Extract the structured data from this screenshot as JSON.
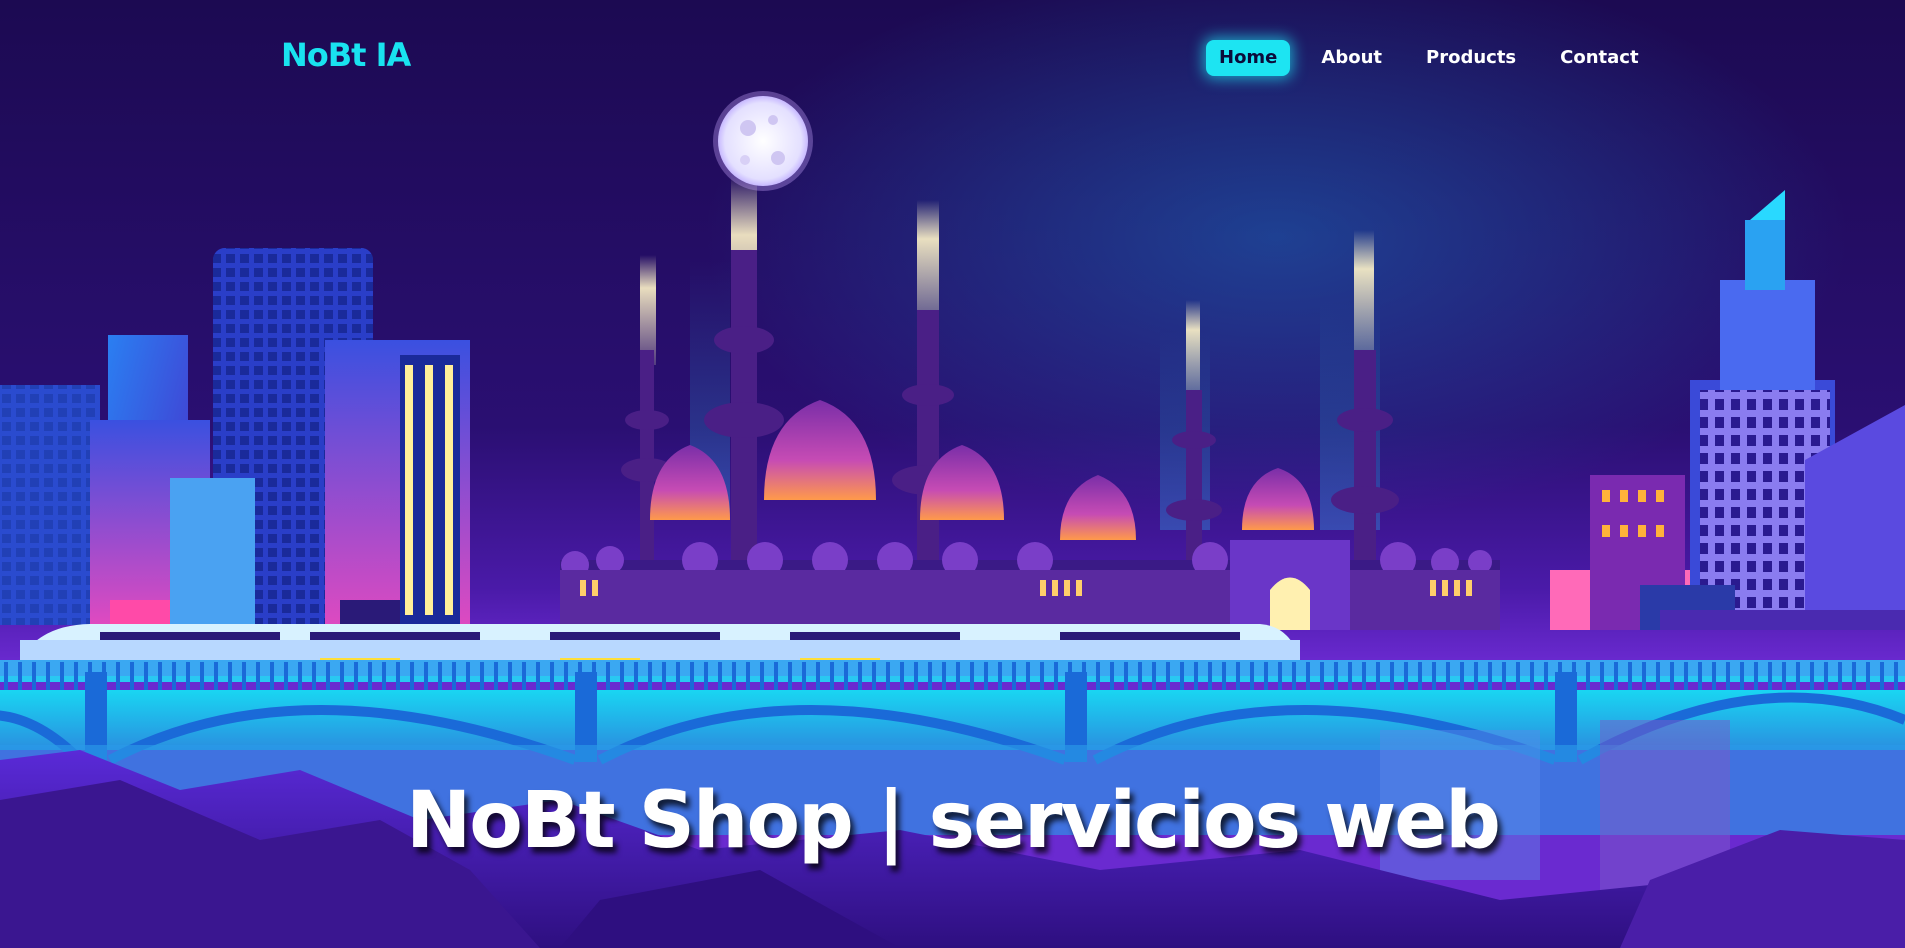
{
  "nav": {
    "brand": "NoBt IA",
    "links": [
      {
        "label": "Home",
        "active": true
      },
      {
        "label": "About",
        "active": false
      },
      {
        "label": "Products",
        "active": false
      },
      {
        "label": "Contact",
        "active": false
      }
    ]
  },
  "hero": {
    "title": "NoBt Shop | servicios web",
    "background": "neon night cityscape with mosque, train on bridge and moon"
  },
  "colors": {
    "accent": "#1de4f2",
    "sky_top": "#1c0a52",
    "sky_bottom": "#4a1aa8",
    "water": "#1ab8e8",
    "title": "#ffffff"
  }
}
